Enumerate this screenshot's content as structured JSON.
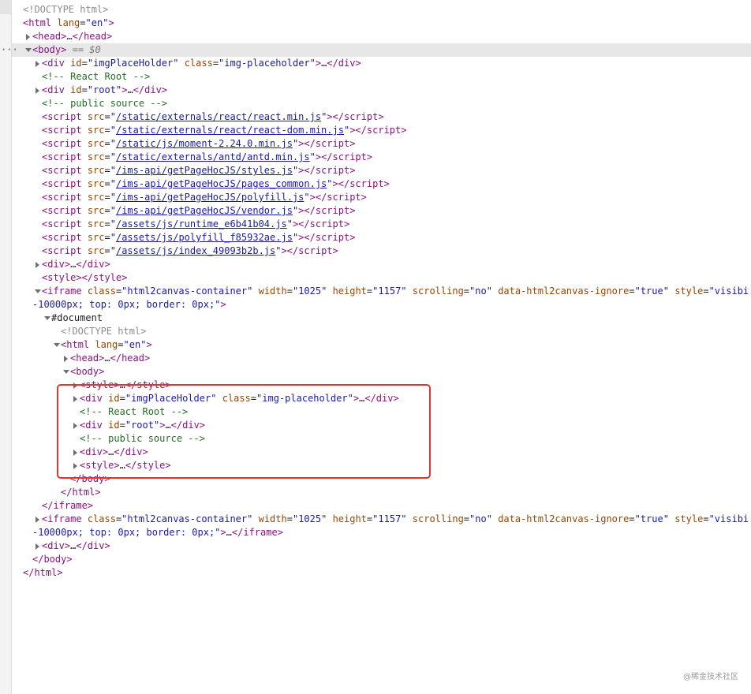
{
  "devtools": {
    "doctype_top": "<!DOCTYPE html>",
    "html_open": "html",
    "lang_attr": "lang",
    "lang_val": "en",
    "head_collapsed": "head",
    "body_tag": "body",
    "selected_marker": "== $0",
    "imgholder_id_val": "imgPlaceHolder",
    "imgholder_class_val": "img-placeholder",
    "comment_react_root": "<!-- React Root -->",
    "root_id_val": "root",
    "comment_public_source": "<!-- public source -->",
    "scripts": [
      "/static/externals/react/react.min.js",
      "/static/externals/react/react-dom.min.js",
      "/static/js/moment-2.24.0.min.js",
      "/static/externals/antd/antd.min.js",
      "/ims-api/getPageHocJS/styles.js",
      "/ims-api/getPageHocJS/pages_common.js",
      "/ims-api/getPageHocJS/polyfill.js",
      "/ims-api/getPageHocJS/vendor.js",
      "/assets/js/runtime_e6b41b04.js",
      "/assets/js/polyfill_f85932ae.js",
      "/assets/js/index_49093b2b.js"
    ],
    "iframe": {
      "class_val": "html2canvas-container",
      "width_val": "1025",
      "height_val": "1157",
      "scrolling_val": "no",
      "ignore_val": "true",
      "style_val_start": "visibi",
      "style_val_cont": "-10000px; top: 0px; border: 0px;"
    },
    "document_node": "#document",
    "doctype_inner": "<!DOCTYPE html>",
    "ellipsis": "…"
  },
  "watermark": "@稀金技术社区"
}
